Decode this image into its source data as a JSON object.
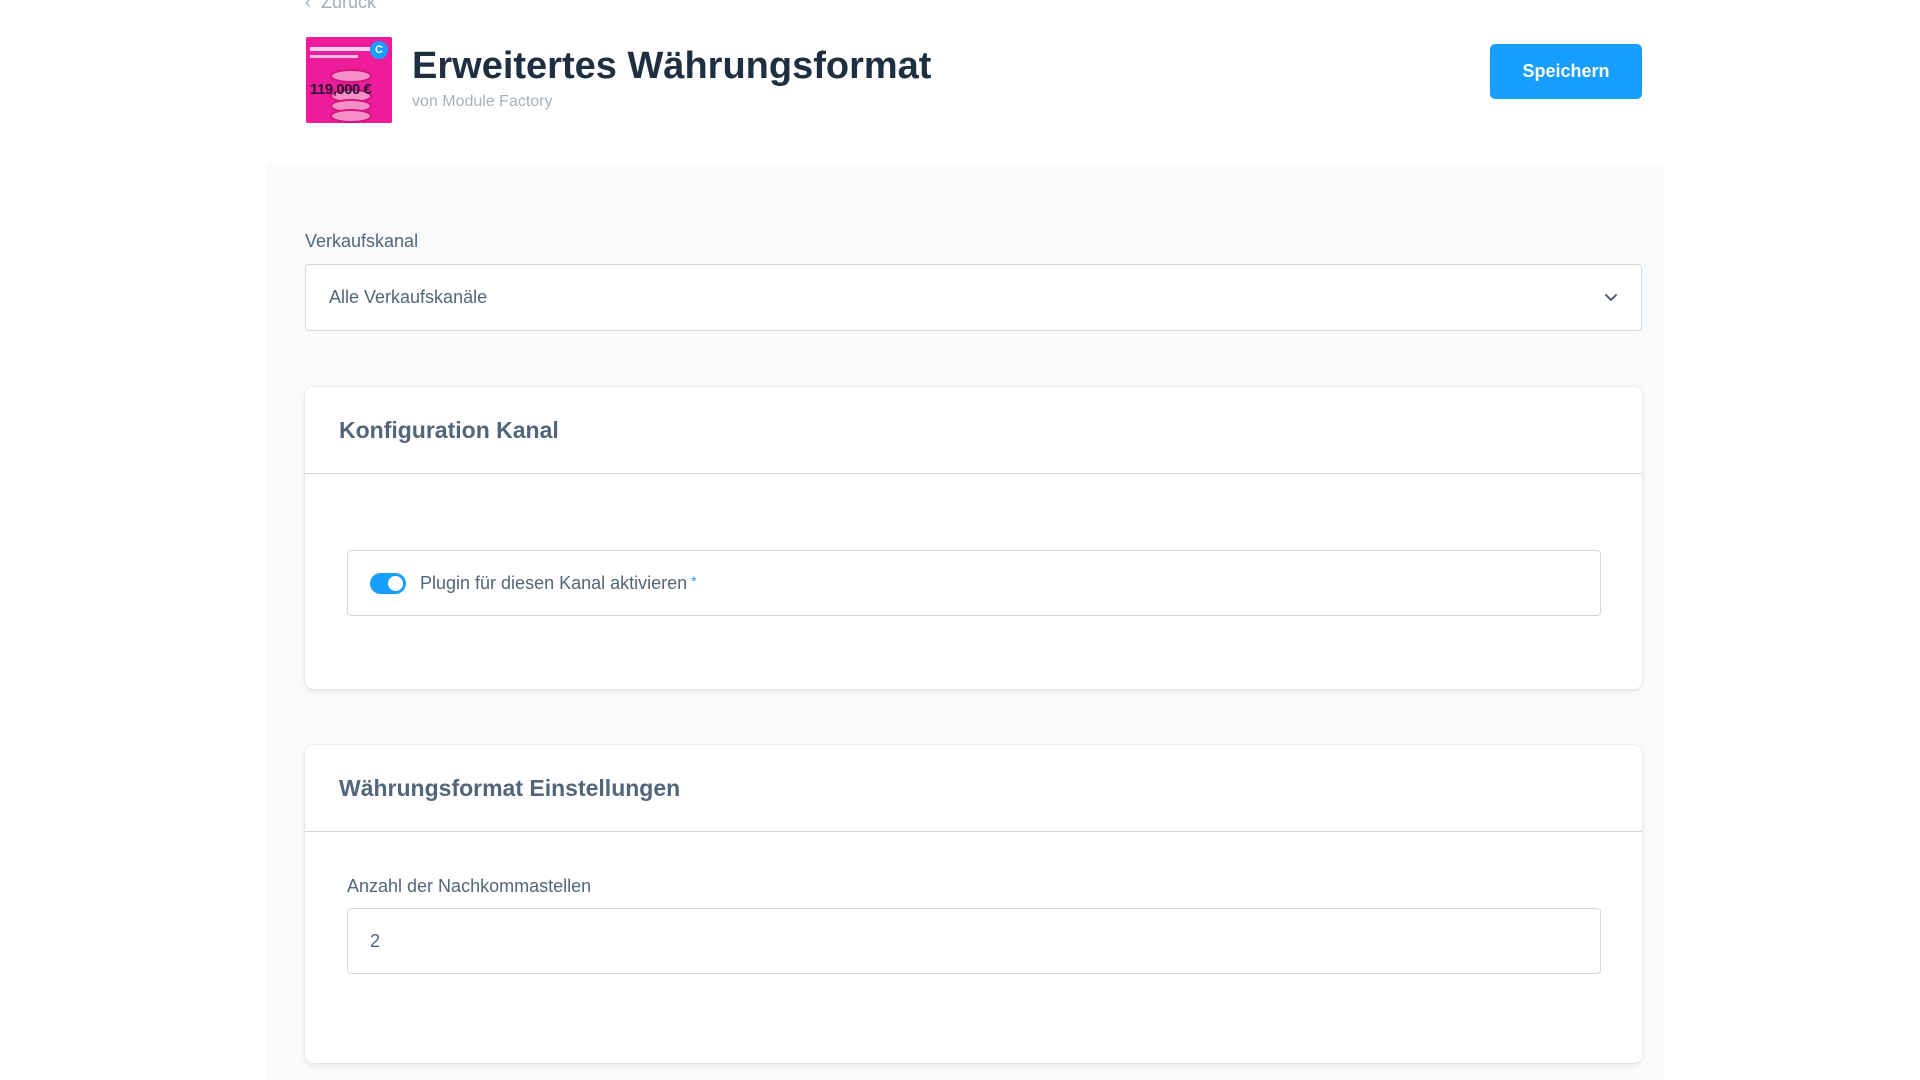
{
  "nav": {
    "back_label": "Zurück"
  },
  "header": {
    "title": "Erweitertes Währungsformat",
    "subtitle": "von Module Factory",
    "icon_text": "119,000 €",
    "save_label": "Speichern"
  },
  "sales_channel": {
    "label": "Verkaufskanal",
    "selected": "Alle Verkaufskanäle"
  },
  "card_channel": {
    "title": "Konfiguration Kanal",
    "toggle_label": "Plugin für diesen Kanal aktivieren",
    "toggle_on": true,
    "required_marker": "*"
  },
  "card_currency": {
    "title": "Währungsformat Einstellungen",
    "field_label": "Anzahl der Nachkommastellen",
    "field_value": "2"
  },
  "colors": {
    "accent": "#189eff",
    "title": "#1f2f42",
    "text": "#52667a",
    "icon_bg": "#ee1c9a"
  }
}
